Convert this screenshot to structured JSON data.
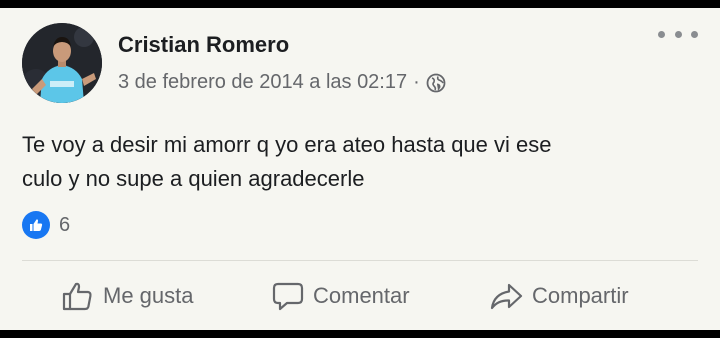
{
  "post": {
    "author": "Cristian Romero",
    "date": "3 de febrero de 2014 a las 02:17",
    "separator": "·",
    "privacy_icon": "globe-icon",
    "text_line1": "Te voy a desir mi amorr q yo era ateo hasta que vi ese",
    "text_line2": "culo y no supe a quien agradecerle",
    "reactions": {
      "icon": "like-reaction-icon",
      "count": "6"
    }
  },
  "actions": {
    "like_label": "Me gusta",
    "comment_label": "Comentar",
    "share_label": "Compartir"
  },
  "colors": {
    "background": "#f6f6f1",
    "text": "#1c1e21",
    "secondary": "#65676b",
    "like_blue": "#1877f2"
  }
}
